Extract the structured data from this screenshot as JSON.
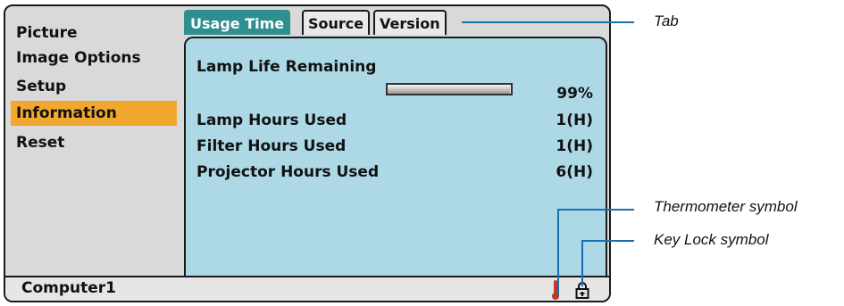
{
  "sidebar": {
    "items": [
      {
        "label": "Picture",
        "active": false
      },
      {
        "label": "Image Options",
        "active": false
      },
      {
        "label": "Setup",
        "active": false
      },
      {
        "label": "Information",
        "active": true
      },
      {
        "label": "Reset",
        "active": false
      }
    ]
  },
  "tabs": [
    {
      "label": "Usage Time",
      "active": true
    },
    {
      "label": "Source",
      "active": false
    },
    {
      "label": "Version",
      "active": false
    }
  ],
  "usage": {
    "lamp_life_label": "Lamp Life Remaining",
    "lamp_life_value": "99%",
    "lamp_life_fraction": 0.99,
    "rows": [
      {
        "label": "Lamp Hours Used",
        "value": "1(H)"
      },
      {
        "label": "Filter Hours Used",
        "value": "1(H)"
      },
      {
        "label": "Projector Hours Used",
        "value": "6(H)"
      }
    ]
  },
  "status_bar": {
    "source": "Computer1",
    "thermometer_icon": "thermometer-icon",
    "keylock_icon": "key-lock-icon"
  },
  "callouts": {
    "tab": "Tab",
    "thermometer": "Thermometer symbol",
    "keylock": "Key Lock symbol"
  },
  "colors": {
    "active_menu": "#f2a72f",
    "active_tab": "#2f8f8f",
    "panel": "#add8e6",
    "thermometer": "#c0392b",
    "leader": "#1a6fb0"
  }
}
